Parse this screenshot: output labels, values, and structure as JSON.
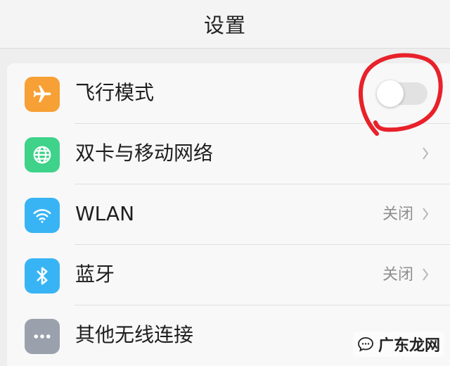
{
  "header": {
    "title": "设置"
  },
  "settings": {
    "items": [
      {
        "label": "飞行模式",
        "icon": "airplane-icon",
        "color": "#f7a035",
        "toggle": false
      },
      {
        "label": "双卡与移动网络",
        "icon": "globe-icon",
        "color": "#3ed28a"
      },
      {
        "label": "WLAN",
        "icon": "wifi-icon",
        "color": "#38b4f5",
        "status": "关闭"
      },
      {
        "label": "蓝牙",
        "icon": "bluetooth-icon",
        "color": "#38b4f5",
        "status": "关闭"
      },
      {
        "label": "其他无线连接",
        "icon": "more-icon",
        "color": "#9aa1ad"
      }
    ]
  },
  "annotation": {
    "color": "#e8212a"
  },
  "watermark": {
    "text": "广东龙网"
  }
}
